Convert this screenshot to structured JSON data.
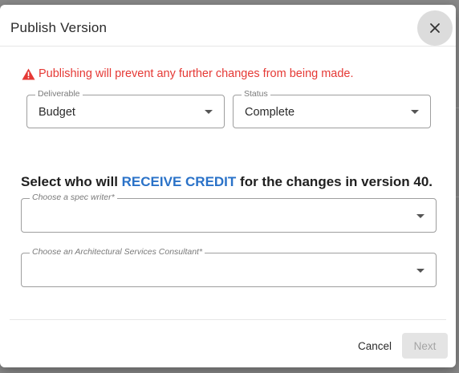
{
  "dialog": {
    "title": "Publish Version",
    "warning": "Publishing will prevent any further changes from being made."
  },
  "deliverable": {
    "label": "Deliverable",
    "value": "Budget"
  },
  "status": {
    "label": "Status",
    "value": "Complete"
  },
  "credit": {
    "prefix": "Select who will",
    "highlight": "RECEIVE CREDIT",
    "suffix": "for the changes in version 40."
  },
  "spec_writer": {
    "label": "Choose a spec writer*",
    "value": ""
  },
  "consultant": {
    "label": "Choose an Architectural Services Consultant*",
    "value": ""
  },
  "footer": {
    "cancel_label": "Cancel",
    "next_label": "Next"
  },
  "colors": {
    "warning": "#e53935",
    "accent": "#2a72c8",
    "disabled_bg": "#e4e4e4"
  }
}
